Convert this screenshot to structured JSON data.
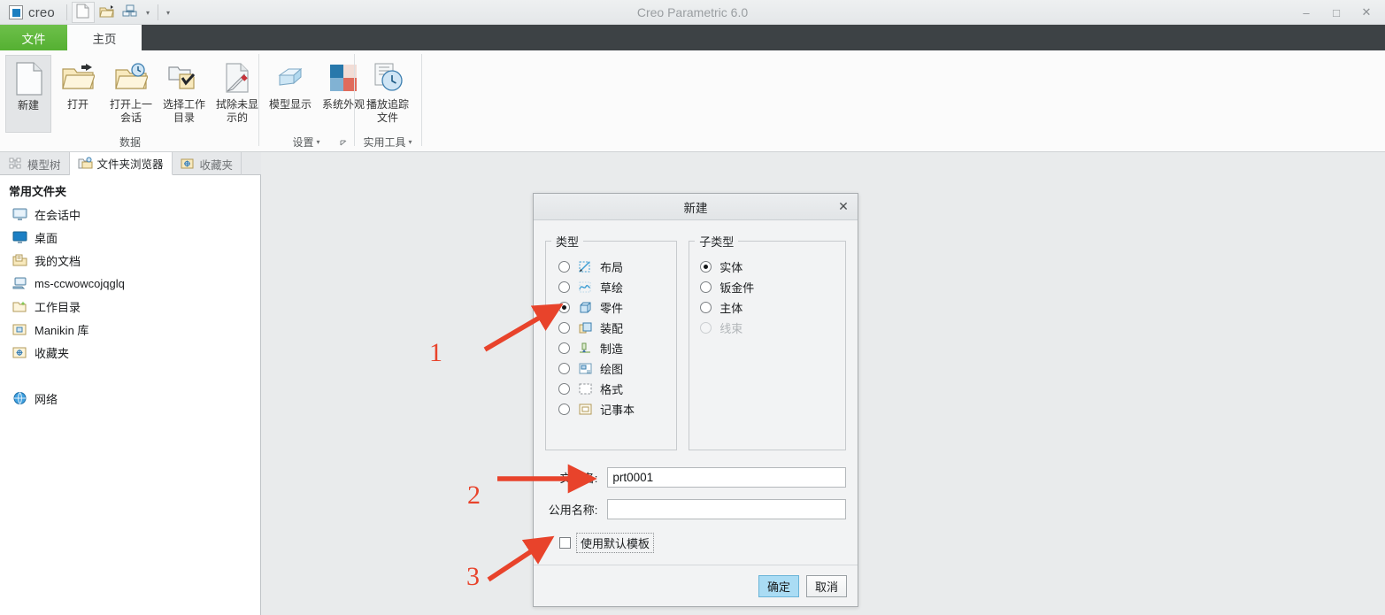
{
  "window": {
    "title": "Creo Parametric 6.0",
    "brand": "creo",
    "controls": {
      "minimize": "–",
      "maximize": "□",
      "close": "✕"
    }
  },
  "quick_access": {
    "new_icon": "new-document-icon",
    "open_icon": "open-folder-icon",
    "regenerate_icon": "regenerate-icon",
    "dropdown_caret": "▾",
    "customize_caret": "▾"
  },
  "tabs": [
    {
      "label": "文件",
      "name": "tab-file"
    },
    {
      "label": "主页",
      "name": "tab-home"
    }
  ],
  "ribbon_right": [
    {
      "name": "collapse-ribbon-icon",
      "glyph": "⌃"
    },
    {
      "name": "search-icon",
      "glyph": "⚲"
    },
    {
      "name": "graduation-cap-icon",
      "glyph": "⌂"
    },
    {
      "name": "help-dropdown-caret",
      "glyph": "▾"
    },
    {
      "name": "help-icon",
      "glyph": "?"
    }
  ],
  "ribbon": {
    "groups": [
      {
        "label": "数据",
        "name": "ribbon-group-data",
        "has_launcher": false,
        "has_caret": false,
        "buttons": [
          {
            "label": "新建",
            "name": "ribbon-button-new",
            "icon": "new-document-icon",
            "selected": true
          },
          {
            "label": "打开",
            "name": "ribbon-button-open",
            "icon": "open-folder-icon",
            "selected": false
          },
          {
            "label": "打开上一\n会话",
            "name": "ribbon-button-open-last-session",
            "icon": "folder-clock-icon",
            "selected": false
          },
          {
            "label": "选择工作\n目录",
            "name": "ribbon-button-select-working-directory",
            "icon": "folder-check-icon",
            "selected": false
          },
          {
            "label": "拭除未显\n示的",
            "name": "ribbon-button-erase-not-displayed",
            "icon": "erase-icon",
            "selected": false
          }
        ]
      },
      {
        "label": "设置",
        "name": "ribbon-group-settings",
        "has_launcher": true,
        "has_caret": true,
        "buttons": [
          {
            "label": "模型显示",
            "name": "ribbon-button-model-display",
            "icon": "model-display-icon",
            "selected": false
          },
          {
            "label": "系统外观",
            "name": "ribbon-button-system-appearance",
            "icon": "system-appearance-icon",
            "selected": false
          }
        ]
      },
      {
        "label": "实用工具",
        "name": "ribbon-group-utilities",
        "has_launcher": false,
        "has_caret": true,
        "buttons": [
          {
            "label": "播放追踪\n文件",
            "name": "ribbon-button-play-trail-file",
            "icon": "play-trail-icon",
            "selected": false
          }
        ]
      }
    ]
  },
  "navigator": {
    "tabs": [
      {
        "label": "模型树",
        "name": "nav-tab-model-tree",
        "icon": "model-tree-icon",
        "active": false
      },
      {
        "label": "文件夹浏览器",
        "name": "nav-tab-folder-browser",
        "icon": "folder-browser-icon",
        "active": true
      },
      {
        "label": "收藏夹",
        "name": "nav-tab-favorites",
        "icon": "favorites-icon",
        "active": false
      }
    ],
    "heading": "常用文件夹",
    "items": [
      {
        "label": "在会话中",
        "name": "nav-item-in-session",
        "icon": "monitor-icon"
      },
      {
        "label": "桌面",
        "name": "nav-item-desktop",
        "icon": "desktop-icon"
      },
      {
        "label": "我的文档",
        "name": "nav-item-my-documents",
        "icon": "documents-folder-icon"
      },
      {
        "label": "ms-ccwowcojqglq",
        "name": "nav-item-computer",
        "icon": "computer-icon"
      },
      {
        "label": "工作目录",
        "name": "nav-item-working-directory",
        "icon": "working-folder-icon"
      },
      {
        "label": "Manikin 库",
        "name": "nav-item-manikin-library",
        "icon": "library-folder-icon"
      },
      {
        "label": "收藏夹",
        "name": "nav-item-favorites",
        "icon": "favorites-folder-icon"
      }
    ],
    "network": {
      "label": "网络",
      "name": "nav-item-network",
      "icon": "network-globe-icon"
    }
  },
  "dialog": {
    "title": "新建",
    "close_glyph": "✕",
    "type_group": {
      "legend": "类型",
      "options": [
        {
          "label": "布局",
          "name": "radio-type-layout",
          "icon": "layout-icon",
          "selected": false,
          "disabled": false
        },
        {
          "label": "草绘",
          "name": "radio-type-sketch",
          "icon": "sketch-icon",
          "selected": false,
          "disabled": false
        },
        {
          "label": "零件",
          "name": "radio-type-part",
          "icon": "part-icon",
          "selected": true,
          "disabled": false
        },
        {
          "label": "装配",
          "name": "radio-type-assembly",
          "icon": "assembly-icon",
          "selected": false,
          "disabled": false
        },
        {
          "label": "制造",
          "name": "radio-type-manufacturing",
          "icon": "manufacturing-icon",
          "selected": false,
          "disabled": false
        },
        {
          "label": "绘图",
          "name": "radio-type-drawing",
          "icon": "drawing-icon",
          "selected": false,
          "disabled": false
        },
        {
          "label": "格式",
          "name": "radio-type-format",
          "icon": "format-icon",
          "selected": false,
          "disabled": false
        },
        {
          "label": "记事本",
          "name": "radio-type-notebook",
          "icon": "notebook-icon",
          "selected": false,
          "disabled": false
        }
      ]
    },
    "subtype_group": {
      "legend": "子类型",
      "options": [
        {
          "label": "实体",
          "name": "radio-subtype-solid",
          "selected": true,
          "disabled": false
        },
        {
          "label": "钣金件",
          "name": "radio-subtype-sheetmetal",
          "selected": false,
          "disabled": false
        },
        {
          "label": "主体",
          "name": "radio-subtype-body",
          "selected": false,
          "disabled": false
        },
        {
          "label": "线束",
          "name": "radio-subtype-harness",
          "selected": false,
          "disabled": true
        }
      ]
    },
    "fields": [
      {
        "label": "文件名:",
        "name": "file-name-field",
        "value": "prt0001",
        "placeholder": ""
      },
      {
        "label": "公用名称:",
        "name": "common-name-field",
        "value": "",
        "placeholder": ""
      }
    ],
    "checkbox": {
      "label": "使用默认模板",
      "name": "use-default-template-checkbox",
      "checked": false
    },
    "buttons": [
      {
        "label": "确定",
        "name": "ok-button",
        "primary": true
      },
      {
        "label": "取消",
        "name": "cancel-button",
        "primary": false
      }
    ]
  },
  "annotations": {
    "color": "#e8432b",
    "steps": [
      {
        "number": "1",
        "name": "annotation-step-1"
      },
      {
        "number": "2",
        "name": "annotation-step-2"
      },
      {
        "number": "3",
        "name": "annotation-step-3"
      }
    ]
  }
}
